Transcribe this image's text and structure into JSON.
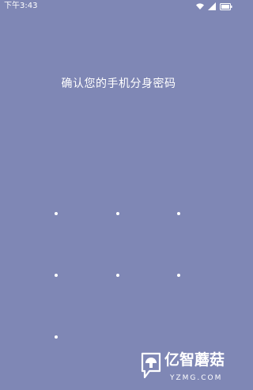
{
  "status_bar": {
    "time": "下午3:43",
    "icons": [
      "wifi-icon",
      "signal-icon",
      "battery-icon"
    ]
  },
  "prompt": {
    "text": "确认您的手机分身密码"
  },
  "pattern": {
    "visible_dots": 7
  },
  "watermark": {
    "title": "亿智蘑菇",
    "subtitle": "YZMG.COM"
  },
  "colors": {
    "background": "#7f87b5",
    "foreground": "#ffffff"
  }
}
